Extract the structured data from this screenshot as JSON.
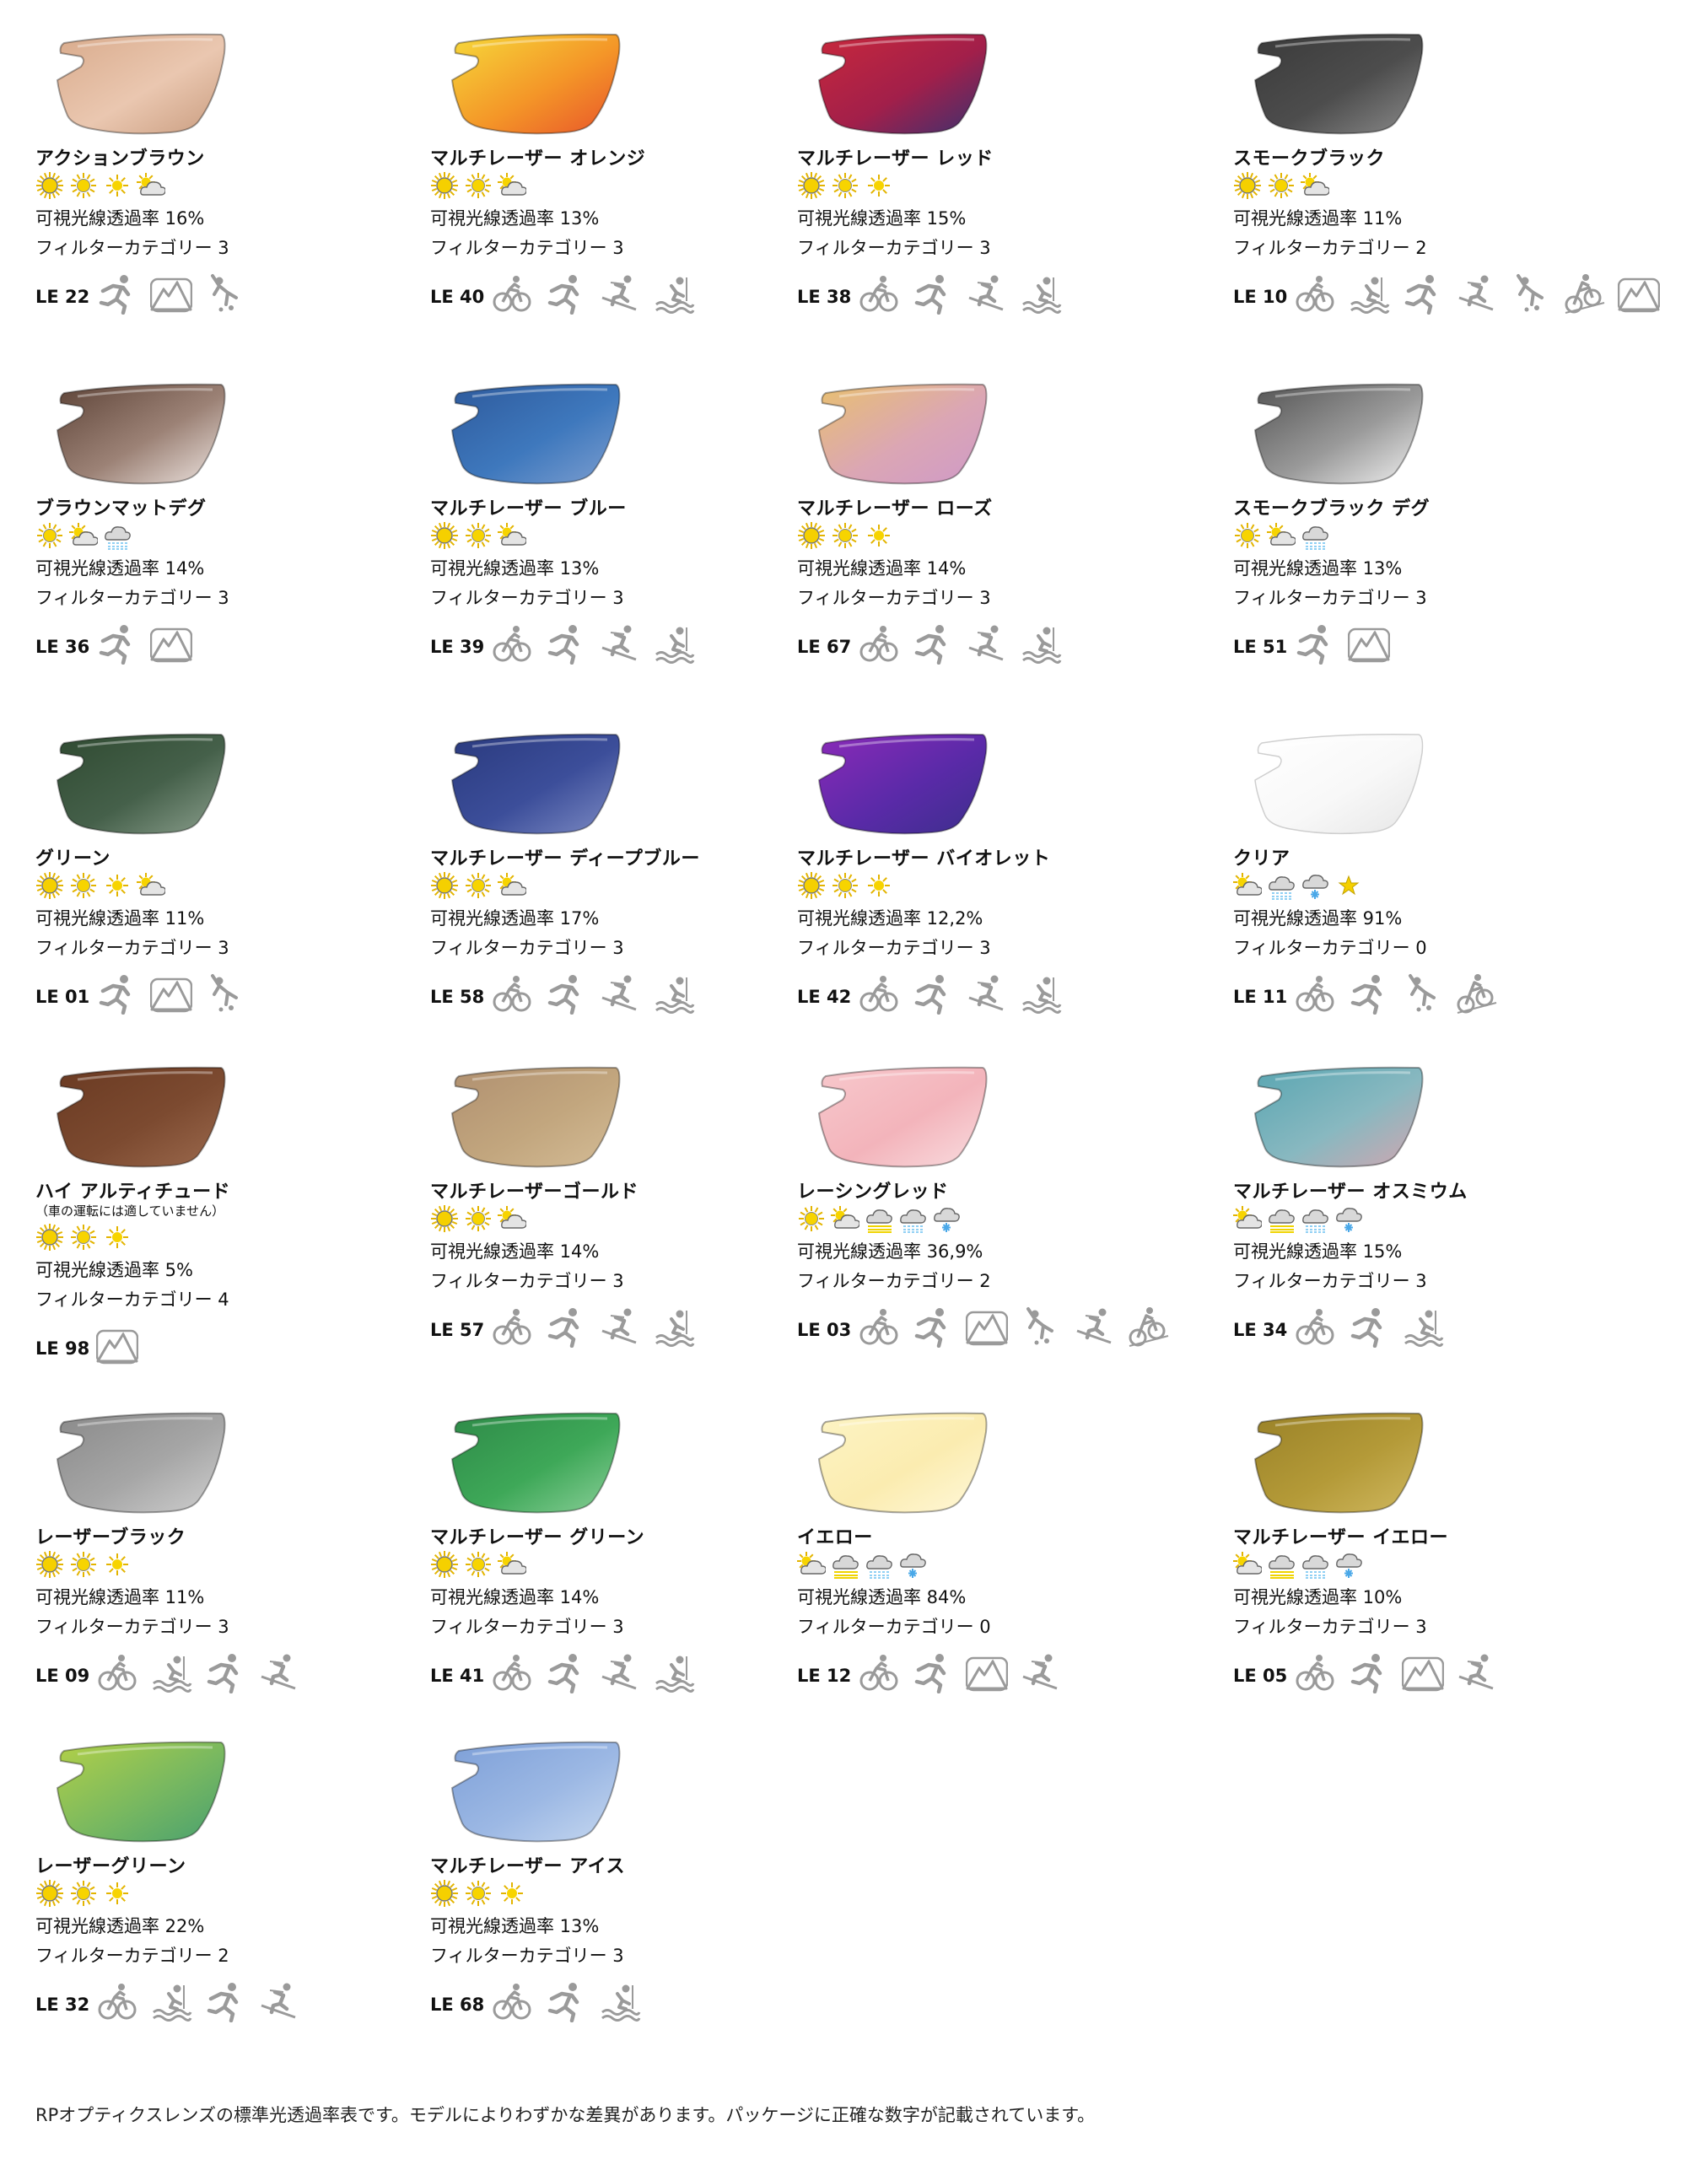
{
  "lenses": [
    {
      "name": "アクションブラウン",
      "weather": [
        "sun-bright",
        "sun",
        "sun-small",
        "sun-cloud"
      ],
      "transmission": "可視光線透過率 16%",
      "category": "フィルターカテゴリー 3",
      "code": "LE 22",
      "sports": [
        "running",
        "mountain",
        "climbing"
      ],
      "lens_colors": [
        "#d9ab8c",
        "#eac7b0",
        "#c99c7f"
      ]
    },
    {
      "name": "マルチレーザー オレンジ",
      "weather": [
        "sun-bright",
        "sun",
        "sun-cloud"
      ],
      "transmission": "可視光線透過率 13%",
      "category": "フィルターカテゴリー 3",
      "code": "LE 40",
      "sports": [
        "cycling",
        "running",
        "ski",
        "water"
      ],
      "lens_colors": [
        "#f6d93a",
        "#f49628",
        "#e8542a"
      ]
    },
    {
      "name": "マルチレーザー レッド",
      "weather": [
        "sun-bright",
        "sun",
        "sun-small"
      ],
      "transmission": "可視光線透過率 15%",
      "category": "フィルターカテゴリー 3",
      "code": "LE 38",
      "sports": [
        "cycling",
        "running",
        "ski",
        "water"
      ],
      "lens_colors": [
        "#c8283c",
        "#a21f4a",
        "#3b3170"
      ]
    },
    {
      "name": "スモークブラック",
      "weather": [
        "sun-bright",
        "sun",
        "sun-cloud"
      ],
      "transmission": "可視光線透過率 11%",
      "category": "フィルターカテゴリー 2",
      "code": "LE 10",
      "sports": [
        "cycling",
        "water",
        "running",
        "ski",
        "climbing",
        "mtb",
        "mountain"
      ],
      "lens_colors": [
        "#3a3a3a",
        "#4d4d4d",
        "#8c8c8c"
      ]
    },
    {
      "name": "ブラウンマットデグ",
      "weather": [
        "sun",
        "sun-cloud",
        "cloud-rain"
      ],
      "transmission": "可視光線透過率 14%",
      "category": "フィルターカテゴリー 3",
      "code": "LE 36",
      "sports": [
        "running",
        "mountain"
      ],
      "lens_colors": [
        "#5e4438",
        "#9c8276",
        "#efe6e2"
      ]
    },
    {
      "name": "マルチレーザー ブルー",
      "weather": [
        "sun-bright",
        "sun",
        "sun-cloud"
      ],
      "transmission": "可視光線透過率 13%",
      "category": "フィルターカテゴリー 3",
      "code": "LE 39",
      "sports": [
        "cycling",
        "running",
        "ski",
        "water"
      ],
      "lens_colors": [
        "#2e5a9c",
        "#3e78bd",
        "#7e9fd0"
      ]
    },
    {
      "name": "マルチレーザー ローズ",
      "weather": [
        "sun-bright",
        "sun",
        "sun-small"
      ],
      "transmission": "可視光線透過率 14%",
      "category": "フィルターカテゴリー 3",
      "code": "LE 67",
      "sports": [
        "cycling",
        "running",
        "ski",
        "water"
      ],
      "lens_colors": [
        "#e8c070",
        "#dba6b4",
        "#cf9ac8"
      ]
    },
    {
      "name": "スモークブラック デグ",
      "weather": [
        "sun",
        "sun-cloud",
        "cloud-rain"
      ],
      "transmission": "可視光線透過率 13%",
      "category": "フィルターカテゴリー 3",
      "code": "LE 51",
      "sports": [
        "running",
        "mountain"
      ],
      "lens_colors": [
        "#545454",
        "#9a9a9a",
        "#f2f2f2"
      ]
    },
    {
      "name": "グリーン",
      "weather": [
        "sun-bright",
        "sun",
        "sun-small",
        "sun-cloud"
      ],
      "transmission": "可視光線透過率 11%",
      "category": "フィルターカテゴリー 3",
      "code": "LE 01",
      "sports": [
        "running",
        "mountain",
        "climbing"
      ],
      "lens_colors": [
        "#2f4a31",
        "#45604a",
        "#8ca08e"
      ]
    },
    {
      "name": "マルチレーザー ディープブルー",
      "weather": [
        "sun-bright",
        "sun",
        "sun-cloud"
      ],
      "transmission": "可視光線透過率 17%",
      "category": "フィルターカテゴリー 3",
      "code": "LE 58",
      "sports": [
        "cycling",
        "running",
        "ski",
        "water"
      ],
      "lens_colors": [
        "#2a3a7e",
        "#3c4e9a",
        "#7e8cc4"
      ]
    },
    {
      "name": "マルチレーザー バイオレット",
      "weather": [
        "sun-bright",
        "sun",
        "sun-small"
      ],
      "transmission": "可視光線透過率 12,2%",
      "category": "フィルターカテゴリー 3",
      "code": "LE 42",
      "sports": [
        "cycling",
        "running",
        "ski",
        "water"
      ],
      "lens_colors": [
        "#8a2ab8",
        "#5a2aa8",
        "#3c2f8c"
      ]
    },
    {
      "name": "クリア",
      "weather": [
        "sun-cloud",
        "cloud-rain",
        "cloud-snow",
        "star"
      ],
      "transmission": "可視光線透過率 91%",
      "category": "フィルターカテゴリー 0",
      "code": "LE 11",
      "sports": [
        "cycling",
        "running",
        "climbing",
        "mtb"
      ],
      "lens_colors": [
        "#ffffff",
        "#f8f8f8",
        "#e6e6e6"
      ]
    },
    {
      "name": "ハイ アルティチュード",
      "note": "（車の運転には適していません）",
      "weather": [
        "sun-bright",
        "sun",
        "sun-small"
      ],
      "transmission": "可視光線透過率 5%",
      "category": "フィルターカテゴリー 4",
      "code": "LE 98",
      "sports": [
        "mountain"
      ],
      "lens_colors": [
        "#6a3a22",
        "#7c4a30",
        "#9c6a4e"
      ]
    },
    {
      "name": "マルチレーザーゴールド",
      "weather": [
        "sun-bright",
        "sun",
        "sun-cloud"
      ],
      "transmission": "可視光線透過率 14%",
      "category": "フィルターカテゴリー 3",
      "code": "LE 57",
      "sports": [
        "cycling",
        "running",
        "ski",
        "water"
      ],
      "lens_colors": [
        "#b09070",
        "#c2a67e",
        "#d4bc96"
      ]
    },
    {
      "name": "レーシングレッド",
      "weather": [
        "sun",
        "sun-cloud",
        "cloud-fog",
        "cloud-rain",
        "cloud-snow"
      ],
      "transmission": "可視光線透過率 36,9%",
      "category": "フィルターカテゴリー 2",
      "code": "LE 03",
      "sports": [
        "cycling",
        "running",
        "mountain",
        "climbing",
        "ski",
        "mtb"
      ],
      "lens_colors": [
        "#f7c8cc",
        "#f3b4bb",
        "#f9dde0"
      ]
    },
    {
      "name": "マルチレーザー オスミウム",
      "weather": [
        "sun-cloud",
        "cloud-fog",
        "cloud-rain",
        "cloud-snow"
      ],
      "transmission": "可視光線透過率 15%",
      "category": "フィルターカテゴリー 3",
      "code": "LE 34",
      "sports": [
        "cycling",
        "running",
        "water"
      ],
      "lens_colors": [
        "#5aa6b2",
        "#88b8c0",
        "#d2a6b0"
      ]
    },
    {
      "name": "レーザーブラック",
      "weather": [
        "sun-bright",
        "sun",
        "sun-small"
      ],
      "transmission": "可視光線透過率 11%",
      "category": "フィルターカテゴリー 3",
      "code": "LE 09",
      "sports": [
        "cycling",
        "water",
        "running",
        "ski"
      ],
      "lens_colors": [
        "#8a8a8a",
        "#a6a6a6",
        "#d0d0d0"
      ]
    },
    {
      "name": "マルチレーザー グリーン",
      "weather": [
        "sun-bright",
        "sun",
        "sun-cloud"
      ],
      "transmission": "可視光線透過率 14%",
      "category": "フィルターカテゴリー 3",
      "code": "LE 41",
      "sports": [
        "cycling",
        "running",
        "ski",
        "water"
      ],
      "lens_colors": [
        "#2e8a48",
        "#3ea858",
        "#8cd09a"
      ]
    },
    {
      "name": "イエロー",
      "weather": [
        "sun-cloud",
        "cloud-fog",
        "cloud-rain",
        "cloud-snow"
      ],
      "transmission": "可視光線透過率 84%",
      "category": "フィルターカテゴリー 0",
      "code": "LE 12",
      "sports": [
        "cycling",
        "running",
        "mountain",
        "ski"
      ],
      "lens_colors": [
        "#fdf4c4",
        "#fbecb0",
        "#fff8da"
      ]
    },
    {
      "name": "マルチレーザー イエロー",
      "weather": [
        "sun-cloud",
        "cloud-fog",
        "cloud-rain",
        "cloud-snow"
      ],
      "transmission": "可視光線透過率 10%",
      "category": "フィルターカテゴリー 3",
      "code": "LE 05",
      "sports": [
        "cycling",
        "running",
        "mountain",
        "ski"
      ],
      "lens_colors": [
        "#9a8228",
        "#b49a38",
        "#d0b860"
      ]
    },
    {
      "name": "レーザーグリーン",
      "weather": [
        "sun-bright",
        "sun",
        "sun-small"
      ],
      "transmission": "可視光線透過率 22%",
      "category": "フィルターカテゴリー 2",
      "code": "LE 32",
      "sports": [
        "cycling",
        "water",
        "running",
        "ski"
      ],
      "lens_colors": [
        "#b2d048",
        "#78b860",
        "#48a070"
      ]
    },
    {
      "name": "マルチレーザー アイス",
      "weather": [
        "sun-bright",
        "sun",
        "sun-small"
      ],
      "transmission": "可視光線透過率 13%",
      "category": "フィルターカテゴリー 3",
      "code": "LE 68",
      "sports": [
        "cycling",
        "running",
        "water"
      ],
      "lens_colors": [
        "#7ea0d8",
        "#9cb8e4",
        "#c6d8f0"
      ]
    }
  ],
  "footer": "RPオプティクスレンズの標準光透過率表です。モデルによりわずかな差異があります。パッケージに正確な数字が記載されています。"
}
